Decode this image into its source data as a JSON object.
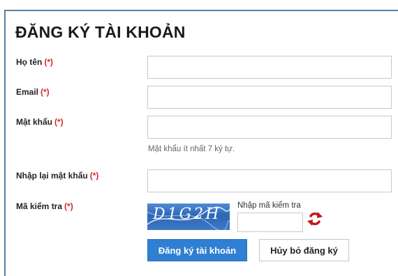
{
  "form": {
    "title": "ĐĂNG KÝ TÀI KHOẢN",
    "required_marker": "(*)",
    "fields": {
      "fullname": {
        "label": "Họ tên",
        "value": ""
      },
      "email": {
        "label": "Email",
        "value": ""
      },
      "password": {
        "label": "Mật khẩu",
        "value": "",
        "hint": "Mật khẩu ít nhất 7 ký tự."
      },
      "confirm_password": {
        "label": "Nhập lại mật khẩu",
        "value": ""
      },
      "captcha": {
        "label": "Mã kiểm tra",
        "image_text": "D1G2H",
        "input_label": "Nhập mã kiểm tra",
        "value": ""
      }
    },
    "buttons": {
      "submit": "Đăng ký tài khoản",
      "cancel": "Hủy bỏ đăng ký"
    }
  },
  "icons": {
    "refresh": "refresh-icon"
  },
  "colors": {
    "accent": "#2f7fd3",
    "required": "#d8262b",
    "panel_border": "#5a7fa8",
    "refresh_icon": "#c0191f"
  }
}
